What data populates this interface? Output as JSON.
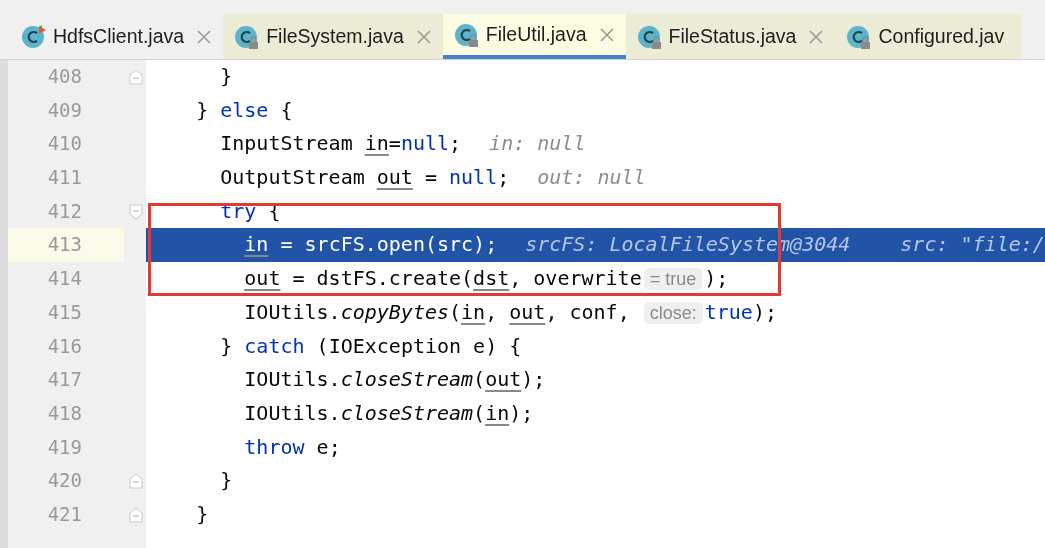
{
  "tabs": [
    {
      "label": "HdfsClient.java",
      "selected": false,
      "kind": "project",
      "locked": false,
      "runnable": true
    },
    {
      "label": "FileSystem.java",
      "selected": false,
      "kind": "library",
      "locked": true,
      "runnable": false
    },
    {
      "label": "FileUtil.java",
      "selected": true,
      "kind": "library",
      "locked": true,
      "runnable": false
    },
    {
      "label": "FileStatus.java",
      "selected": false,
      "kind": "library",
      "locked": true,
      "runnable": false
    },
    {
      "label": "Configured.jav",
      "selected": false,
      "kind": "library",
      "locked": true,
      "runnable": false
    }
  ],
  "lines": [
    {
      "number": "408",
      "fold_start": false,
      "fold_end": true,
      "current": false,
      "boxed": false,
      "tokens": [
        {
          "kind": "text",
          "text": "      }"
        }
      ]
    },
    {
      "number": "409",
      "fold_start": false,
      "fold_end": false,
      "current": false,
      "boxed": false,
      "tokens": [
        {
          "kind": "text",
          "text": "    } "
        },
        {
          "kind": "keyword",
          "text": "else"
        },
        {
          "kind": "text",
          "text": " {"
        }
      ]
    },
    {
      "number": "410",
      "fold_start": false,
      "fold_end": false,
      "current": false,
      "boxed": false,
      "tokens": [
        {
          "kind": "text",
          "text": "      InputStream "
        },
        {
          "kind": "local",
          "text": "in"
        },
        {
          "kind": "text",
          "text": "="
        },
        {
          "kind": "keyword",
          "text": "null"
        },
        {
          "kind": "text",
          "text": ";"
        },
        {
          "kind": "value",
          "text": "in: null"
        }
      ]
    },
    {
      "number": "411",
      "fold_start": false,
      "fold_end": false,
      "current": false,
      "boxed": false,
      "tokens": [
        {
          "kind": "text",
          "text": "      OutputStream "
        },
        {
          "kind": "local",
          "text": "out"
        },
        {
          "kind": "text",
          "text": " = "
        },
        {
          "kind": "keyword",
          "text": "null"
        },
        {
          "kind": "text",
          "text": ";"
        },
        {
          "kind": "value",
          "text": "out: null"
        }
      ]
    },
    {
      "number": "412",
      "fold_start": true,
      "fold_end": false,
      "current": false,
      "boxed": true,
      "tokens": [
        {
          "kind": "keyword",
          "text": "      try"
        },
        {
          "kind": "text",
          "text": " {"
        }
      ]
    },
    {
      "number": "413",
      "fold_start": false,
      "fold_end": false,
      "current": true,
      "boxed": true,
      "tokens": [
        {
          "kind": "local",
          "text": "        in"
        },
        {
          "kind": "text",
          "text": " = srcFS.open(src);"
        },
        {
          "kind": "value",
          "text": "srcFS: LocalFileSystem@3044"
        },
        {
          "kind": "value",
          "text": "src: \"file:/"
        }
      ]
    },
    {
      "number": "414",
      "fold_start": false,
      "fold_end": false,
      "current": false,
      "boxed": true,
      "tokens": [
        {
          "kind": "local",
          "text": "        out"
        },
        {
          "kind": "text",
          "text": " = dstFS.create("
        },
        {
          "kind": "local",
          "text": "dst"
        },
        {
          "kind": "text",
          "text": ", overwrite"
        },
        {
          "kind": "param",
          "text": "= true"
        },
        {
          "kind": "text",
          "text": ");"
        }
      ]
    },
    {
      "number": "415",
      "fold_start": false,
      "fold_end": false,
      "current": false,
      "boxed": false,
      "tokens": [
        {
          "kind": "text",
          "text": "        IOUtils."
        },
        {
          "kind": "method",
          "text": "copyBytes"
        },
        {
          "kind": "text",
          "text": "("
        },
        {
          "kind": "local",
          "text": "in"
        },
        {
          "kind": "text",
          "text": ", "
        },
        {
          "kind": "local",
          "text": "out"
        },
        {
          "kind": "text",
          "text": ", conf, "
        },
        {
          "kind": "param",
          "text": "close:"
        },
        {
          "kind": "keyword",
          "text": "true"
        },
        {
          "kind": "text",
          "text": ");"
        }
      ]
    },
    {
      "number": "416",
      "fold_start": false,
      "fold_end": false,
      "current": false,
      "boxed": false,
      "tokens": [
        {
          "kind": "text",
          "text": "      } "
        },
        {
          "kind": "keyword",
          "text": "catch"
        },
        {
          "kind": "text",
          "text": " (IOException e) {"
        }
      ]
    },
    {
      "number": "417",
      "fold_start": false,
      "fold_end": false,
      "current": false,
      "boxed": false,
      "tokens": [
        {
          "kind": "text",
          "text": "        IOUtils."
        },
        {
          "kind": "method",
          "text": "closeStream"
        },
        {
          "kind": "text",
          "text": "("
        },
        {
          "kind": "local",
          "text": "out"
        },
        {
          "kind": "text",
          "text": ");"
        }
      ]
    },
    {
      "number": "418",
      "fold_start": false,
      "fold_end": false,
      "current": false,
      "boxed": false,
      "tokens": [
        {
          "kind": "text",
          "text": "        IOUtils."
        },
        {
          "kind": "method",
          "text": "closeStream"
        },
        {
          "kind": "text",
          "text": "("
        },
        {
          "kind": "local",
          "text": "in"
        },
        {
          "kind": "text",
          "text": ");"
        }
      ]
    },
    {
      "number": "419",
      "fold_start": false,
      "fold_end": false,
      "current": false,
      "boxed": false,
      "tokens": [
        {
          "kind": "keyword",
          "text": "        throw"
        },
        {
          "kind": "text",
          "text": " e;"
        }
      ]
    },
    {
      "number": "420",
      "fold_start": false,
      "fold_end": true,
      "current": false,
      "boxed": false,
      "tokens": [
        {
          "kind": "text",
          "text": "      }"
        }
      ]
    },
    {
      "number": "421",
      "fold_start": false,
      "fold_end": true,
      "current": false,
      "boxed": false,
      "tokens": [
        {
          "kind": "text",
          "text": "    }"
        }
      ]
    }
  ]
}
